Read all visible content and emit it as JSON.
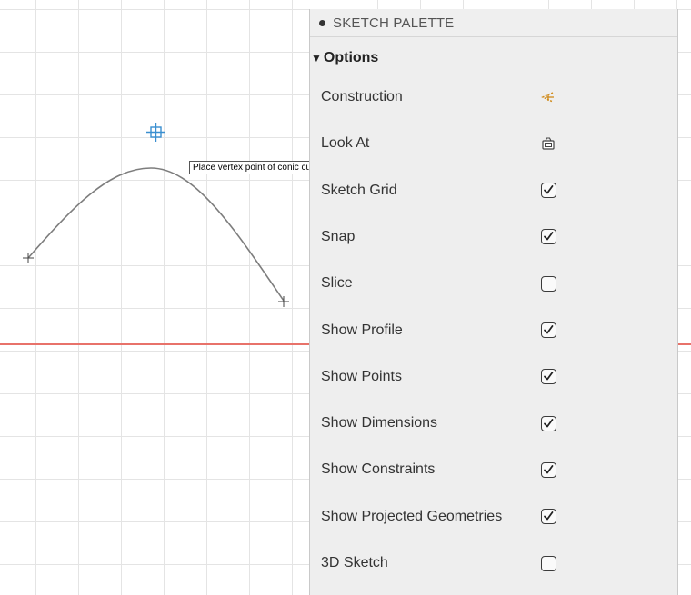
{
  "tooltip": "Place vertex point of conic curve",
  "palette": {
    "title": "SKETCH PALETTE",
    "section": "Options",
    "items": [
      {
        "label": "Construction",
        "control": "icon",
        "icon": "construction-icon"
      },
      {
        "label": "Look At",
        "control": "icon",
        "icon": "look-at-icon"
      },
      {
        "label": "Sketch Grid",
        "control": "checkbox",
        "checked": true
      },
      {
        "label": "Snap",
        "control": "checkbox",
        "checked": true
      },
      {
        "label": "Slice",
        "control": "checkbox",
        "checked": false
      },
      {
        "label": "Show Profile",
        "control": "checkbox",
        "checked": true
      },
      {
        "label": "Show Points",
        "control": "checkbox",
        "checked": true
      },
      {
        "label": "Show Dimensions",
        "control": "checkbox",
        "checked": true
      },
      {
        "label": "Show Constraints",
        "control": "checkbox",
        "checked": true
      },
      {
        "label": "Show Projected Geometries",
        "control": "checkbox",
        "checked": true
      },
      {
        "label": "3D Sketch",
        "control": "checkbox",
        "checked": false
      }
    ]
  },
  "colors": {
    "axis": "#e8726a",
    "vertex_marker": "#3a8fd0",
    "construction_icon": "#d08a1a",
    "grid": "#e4e4e4"
  }
}
